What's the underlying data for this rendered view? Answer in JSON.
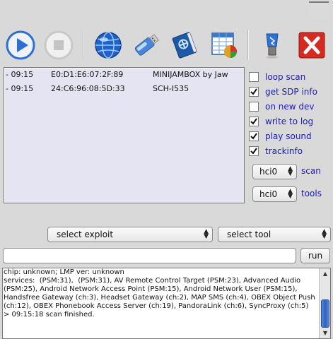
{
  "toolbar": {
    "buttons": [
      {
        "name": "play-button",
        "icon": "play-icon"
      },
      {
        "name": "stop-button",
        "icon": "stop-icon"
      },
      {
        "name": "network-button",
        "icon": "globe-icon"
      },
      {
        "name": "usb-button",
        "icon": "usb-icon"
      },
      {
        "name": "book-button",
        "icon": "book-icon"
      },
      {
        "name": "chart-button",
        "icon": "spreadsheet-chart-icon"
      },
      {
        "name": "bluetooth-button",
        "icon": "bluetooth-dongle-icon"
      },
      {
        "name": "exit-button",
        "icon": "close-x-icon"
      }
    ]
  },
  "devices": [
    {
      "time": "- 09:15",
      "mac": "E0:D1:E6:07:2F:89",
      "name": "MINIJAMBOX by Jaw"
    },
    {
      "time": "- 09:15",
      "mac": "24:C6:96:08:5D:33",
      "name": "SCH-I535"
    }
  ],
  "options": [
    {
      "label": "loop scan",
      "checked": false
    },
    {
      "label": "get SDP info",
      "checked": true
    },
    {
      "label": "on new dev",
      "checked": false
    },
    {
      "label": "write to log",
      "checked": true
    },
    {
      "label": "play sound",
      "checked": true
    },
    {
      "label": "trackinfo",
      "checked": true
    }
  ],
  "scan_select": {
    "value": "hci0",
    "label": "scan"
  },
  "tools_select": {
    "value": "hci0",
    "label": "tools"
  },
  "exploit_select": {
    "value": "select exploit"
  },
  "tool_select": {
    "value": "select tool"
  },
  "command": {
    "value": "",
    "run_label": "run"
  },
  "log": {
    "text": "chip: unknown; LMP ver: unknown\nservices:  (PSM:31),  (PSM:31), AV Remote Control Target (PSM:23), Advanced Audio (PSM:25), Android Network Access Point (PSM:15), Android Network User (PSM:15), Handsfree Gateway (ch:3), Headset Gateway (ch:2), MAP SMS (ch:4), OBEX Object Push (ch:12), OBEX Phonebook Access Server (ch:19), PandoraLink (ch:6), SyncProxy (ch:5)\n> 09:15:18 scan finished."
  },
  "colors": {
    "option_text": "#1a1ab8",
    "list_bg": "#e4e4f2",
    "scroll_thumb": "#2e5fbf"
  }
}
